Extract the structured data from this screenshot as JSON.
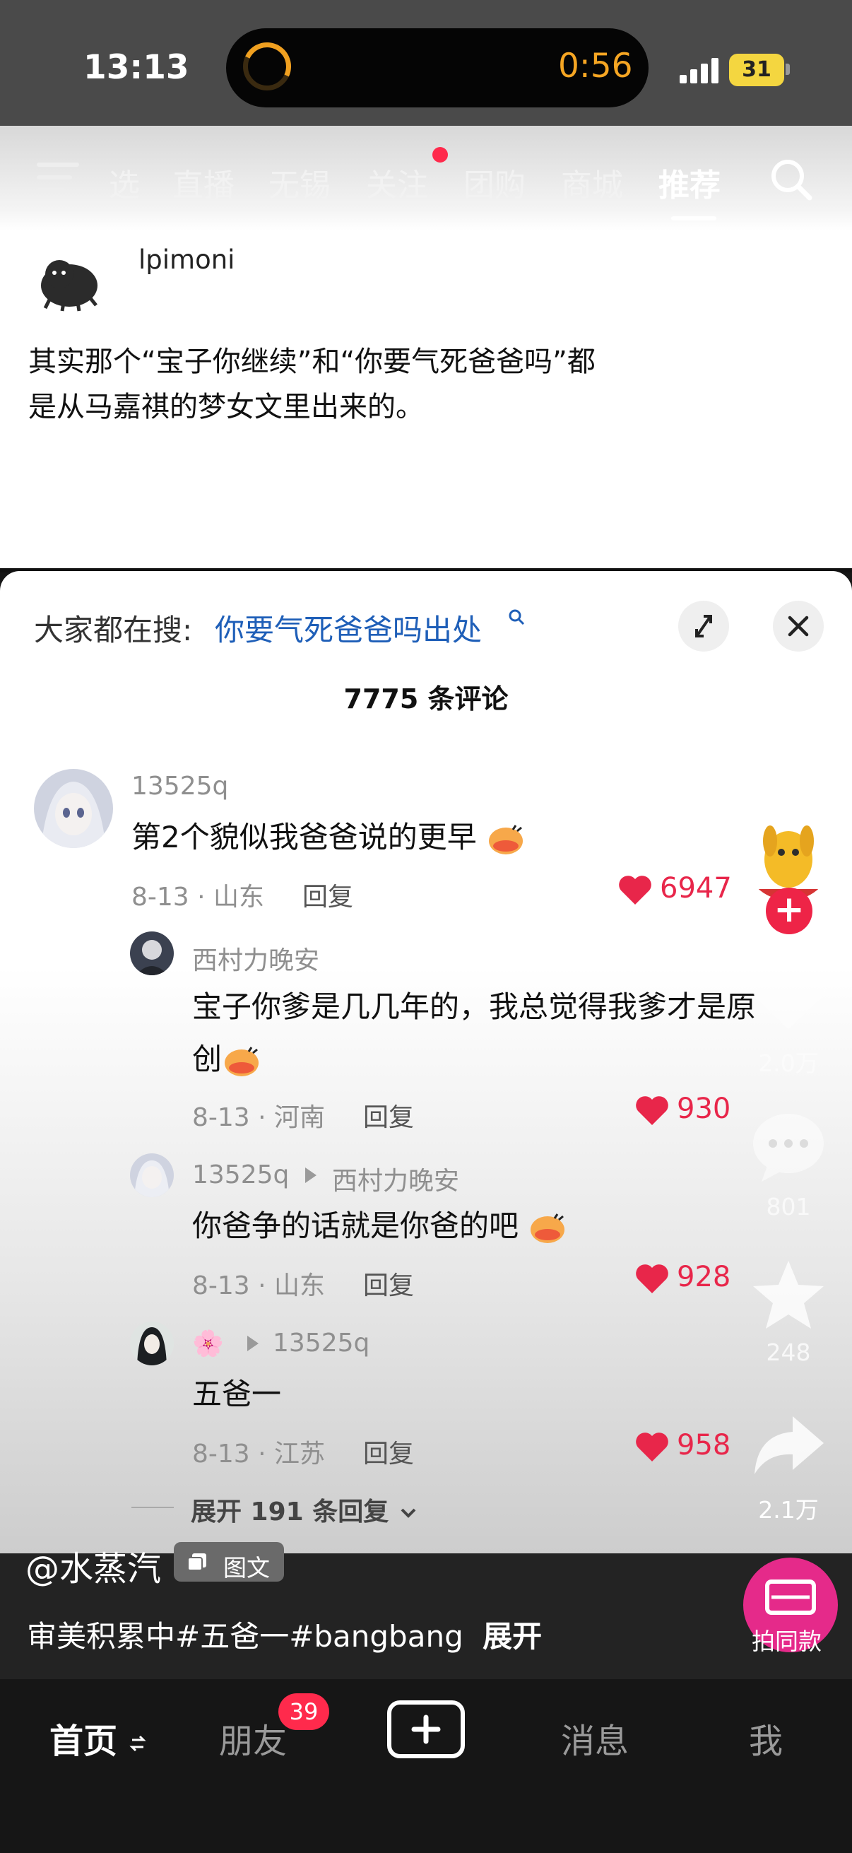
{
  "status_bar": {
    "time": "13:13",
    "timer": "0:56",
    "battery": "31"
  },
  "nav": {
    "tabs": [
      "选",
      "直播",
      "无锡",
      "关注",
      "团购",
      "商城",
      "推荐"
    ],
    "active_tab": "推荐"
  },
  "post": {
    "username": "lpimoni",
    "text_line1": "其实那个“宝子你继续”和“你要气死爸爸吗”都",
    "text_line2": "是从马嘉祺的梦女文里出来的。"
  },
  "comments_panel": {
    "search_prefix": "大家都在搜:",
    "search_term": "你要气死爸爸吗出处",
    "count_label": "7775 条评论",
    "comments": [
      {
        "user": "13525q",
        "text": "第2个貌似我爸爸说的更早",
        "meta": "8-13 · 山东",
        "reply": "回复",
        "likes": "6947"
      },
      {
        "user": "西村力晚安",
        "text_line1": "宝子你爹是几几年的，我总觉得我爹才是原",
        "text_line2": "创",
        "meta": "8-13 · 河南",
        "reply": "回复",
        "likes": "930"
      },
      {
        "user": "13525q",
        "reply_to": "西村力晚安",
        "text": "你爸争的话就是你爸的吧",
        "meta": "8-13 · 山东",
        "reply": "回复",
        "likes": "928"
      },
      {
        "user": "🌸",
        "reply_to": "13525q",
        "text": "五爸一",
        "meta": "8-13 · 江苏",
        "reply": "回复",
        "likes": "958"
      }
    ],
    "expand_replies": "展开 191 条回复"
  },
  "right_rail": {
    "likes": "2.0万",
    "comments": "801",
    "favorites": "248",
    "shares": "2.1万"
  },
  "caption": {
    "author": "@水蒸汽",
    "tag": "图文",
    "description": "审美积累中#五爸一#bangbang",
    "expand": "展开",
    "same_style": "拍同款"
  },
  "bottom_nav": {
    "home": "首页",
    "friends": "朋友",
    "friends_badge": "39",
    "messages": "消息",
    "me": "我"
  },
  "colors": {
    "accent_red": "#e8264a",
    "link_blue": "#1f5fb8",
    "badge_red": "#ff2a4c",
    "timer_orange": "#f6a623"
  }
}
